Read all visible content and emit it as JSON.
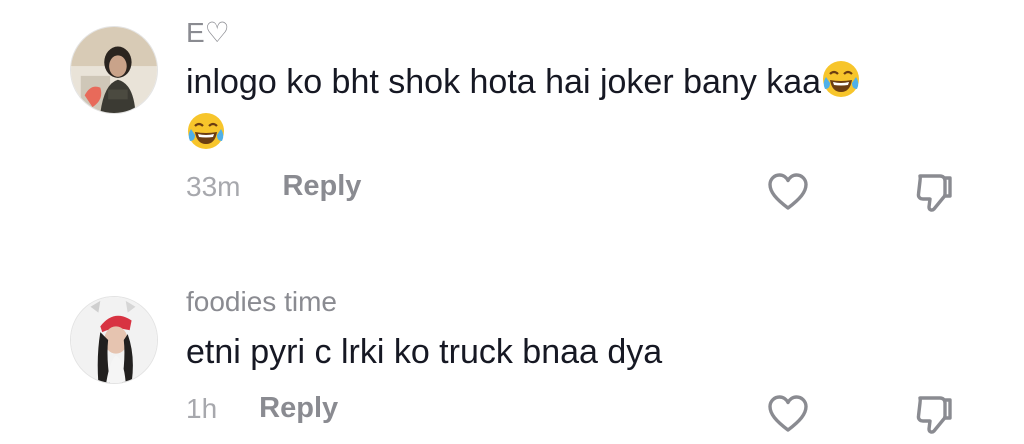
{
  "comments": [
    {
      "username": "E♡",
      "text": "inlogo ko bht shok hota hai joker bany kaa",
      "emojis": [
        "face-with-tears-of-joy",
        "face-with-tears-of-joy"
      ],
      "time": "33m",
      "reply_label": "Reply",
      "avatar_icon": "profile-photo"
    },
    {
      "username": "foodies time",
      "text": "etni pyri c lrki ko truck bnaa dya",
      "time": "1h",
      "reply_label": "Reply",
      "avatar_icon": "profile-photo"
    }
  ],
  "icons": {
    "like": "heart-outline-icon",
    "dislike": "thumbs-down-outline-icon"
  },
  "colors": {
    "text": "#161823",
    "muted": "#8a8b91",
    "time": "#a7a8ad"
  }
}
